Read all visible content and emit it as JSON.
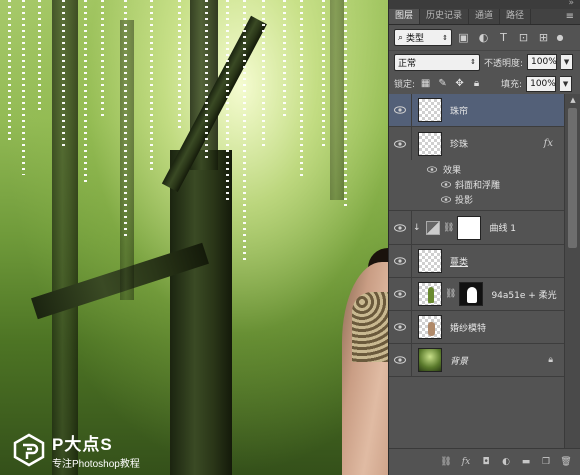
{
  "watermark": {
    "brand": "P大点S",
    "subtitle": "专注Photoshop教程"
  },
  "panel": {
    "tabs": [
      {
        "label": "图层",
        "active": true
      },
      {
        "label": "历史记录",
        "active": false
      },
      {
        "label": "通道",
        "active": false
      },
      {
        "label": "路径",
        "active": false
      }
    ],
    "filter": {
      "search_icon": "search-icon",
      "kind_label": "类型"
    },
    "blend_mode": "正常",
    "opacity_label": "不透明度:",
    "opacity_value": "100%",
    "lock_label": "锁定:",
    "fill_label": "填充:",
    "fill_value": "100%"
  },
  "layers": [
    {
      "name": "珠帘",
      "selected": true
    },
    {
      "name": "珍珠",
      "has_fx": true,
      "fx_label": "fx"
    },
    {
      "name": "曲线 1"
    },
    {
      "name": "蔓类"
    },
    {
      "name": "94a51e + 柔光"
    },
    {
      "name": "婚纱模特"
    },
    {
      "name": "背景",
      "locked": true
    }
  ],
  "effects": {
    "title": "效果",
    "items": [
      "斜面和浮雕",
      "投影"
    ]
  },
  "colors": {
    "panel_bg": "#535353",
    "selected_row": "#536078",
    "tab_bar": "#424242"
  }
}
